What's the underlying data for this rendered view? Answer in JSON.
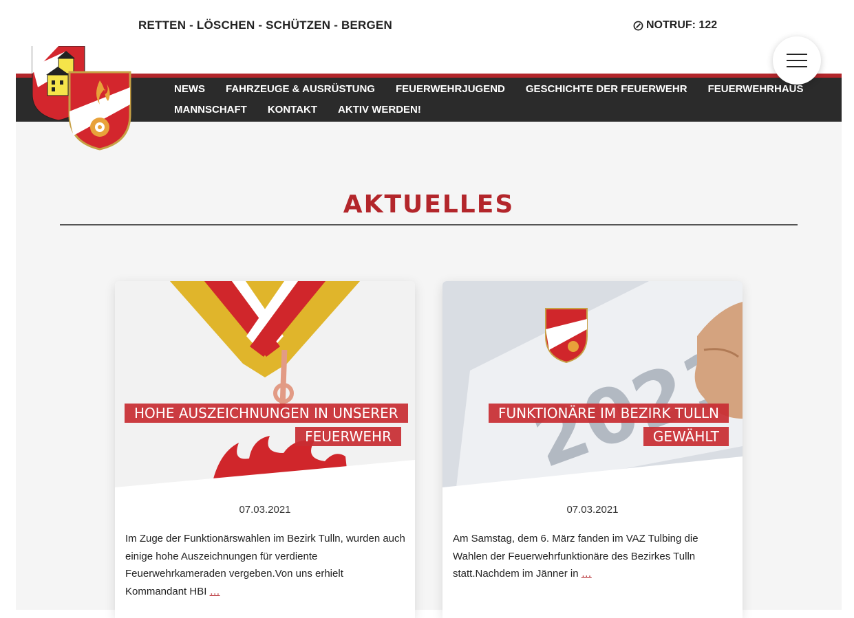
{
  "header": {
    "slogan": "RETTEN - LÖSCHEN - SCHÜTZEN - BERGEN",
    "notruf": "NOTRUF: 122"
  },
  "nav": {
    "items": [
      {
        "label": "NEWS"
      },
      {
        "label": "FAHRZEUGE & AUSRÜSTUNG"
      },
      {
        "label": "FEUERWEHRJUGEND"
      },
      {
        "label": "GESCHICHTE DER FEUERWEHR"
      },
      {
        "label": "FEUERWEHRHAUS"
      },
      {
        "label": "MANNSCHAFT"
      },
      {
        "label": "KONTAKT"
      },
      {
        "label": "AKTIV WERDEN!"
      }
    ]
  },
  "section": {
    "title": "AKTUELLES"
  },
  "posts": [
    {
      "title": "HOHE AUSZEICHNUNGEN IN UNSERER FEUERWEHR",
      "date": "07.03.2021",
      "excerpt": "Im Zuge der Funktionärswahlen im Bezirk Tulln, wurden auch einige hohe Auszeichnungen für verdiente Feuerwehrkameraden vergeben.Von uns erhielt Kommandant HBI",
      "more": "…"
    },
    {
      "title": "FUNKTIONÄRE IM BEZIRK TULLN GEWÄHLT",
      "date": "07.03.2021",
      "excerpt": "Am Samstag, dem 6. März fanden im VAZ Tulbing die Wahlen der Feuerwehrfunktionäre des Bezirkes Tulln statt.Nachdem im Jänner in",
      "more": "…"
    }
  ],
  "colors": {
    "accent": "#b3262b",
    "nav_bg": "#2b2b2b",
    "page_bg": "#f5f5f5"
  }
}
